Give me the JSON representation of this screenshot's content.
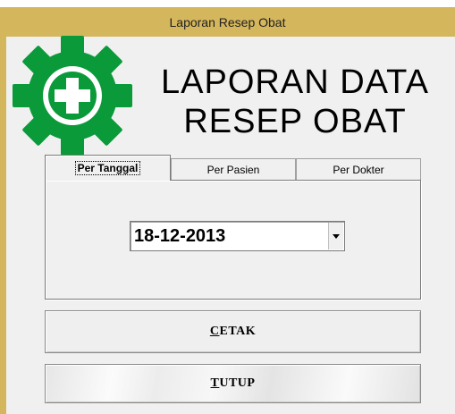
{
  "window": {
    "title": "Laporan Resep Obat"
  },
  "header": {
    "line1": "LAPORAN DATA",
    "line2": "RESEP OBAT"
  },
  "colors": {
    "title_bar": "#d4b65c",
    "logo_green": "#0a9a3a"
  },
  "tabs": [
    {
      "label": "Per Tanggal",
      "active": true
    },
    {
      "label": "Per Pasien",
      "active": false
    },
    {
      "label": "Per Dokter",
      "active": false
    }
  ],
  "date_combo": {
    "value": "18-12-2013"
  },
  "buttons": {
    "cetak": {
      "accel": "C",
      "rest": "ETAK"
    },
    "tutup": {
      "accel": "T",
      "rest": "UTUP"
    }
  }
}
